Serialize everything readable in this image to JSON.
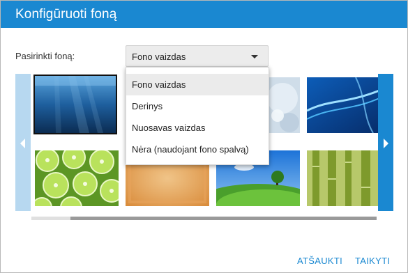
{
  "dialog": {
    "title": "Konfigūruoti foną"
  },
  "background": {
    "label": "Pasirinkti foną:",
    "selected": "Fono vaizdas",
    "options": [
      "Fono vaizdas",
      "Derinys",
      "Nuosavas vaizdas",
      "Nėra (naudojant fono spalvą)"
    ]
  },
  "gallery": {
    "thumbnails": [
      "underwater",
      "ice-crystals",
      "blue-abstract-wave",
      "lime-slices",
      "orange-texture",
      "green-hill-tree",
      "bamboo"
    ]
  },
  "actions": {
    "cancel": "ATŠAUKTI",
    "apply": "TAIKYTI"
  },
  "colors": {
    "accent": "#1a88d1",
    "nav_inactive": "#b7d8f0"
  }
}
